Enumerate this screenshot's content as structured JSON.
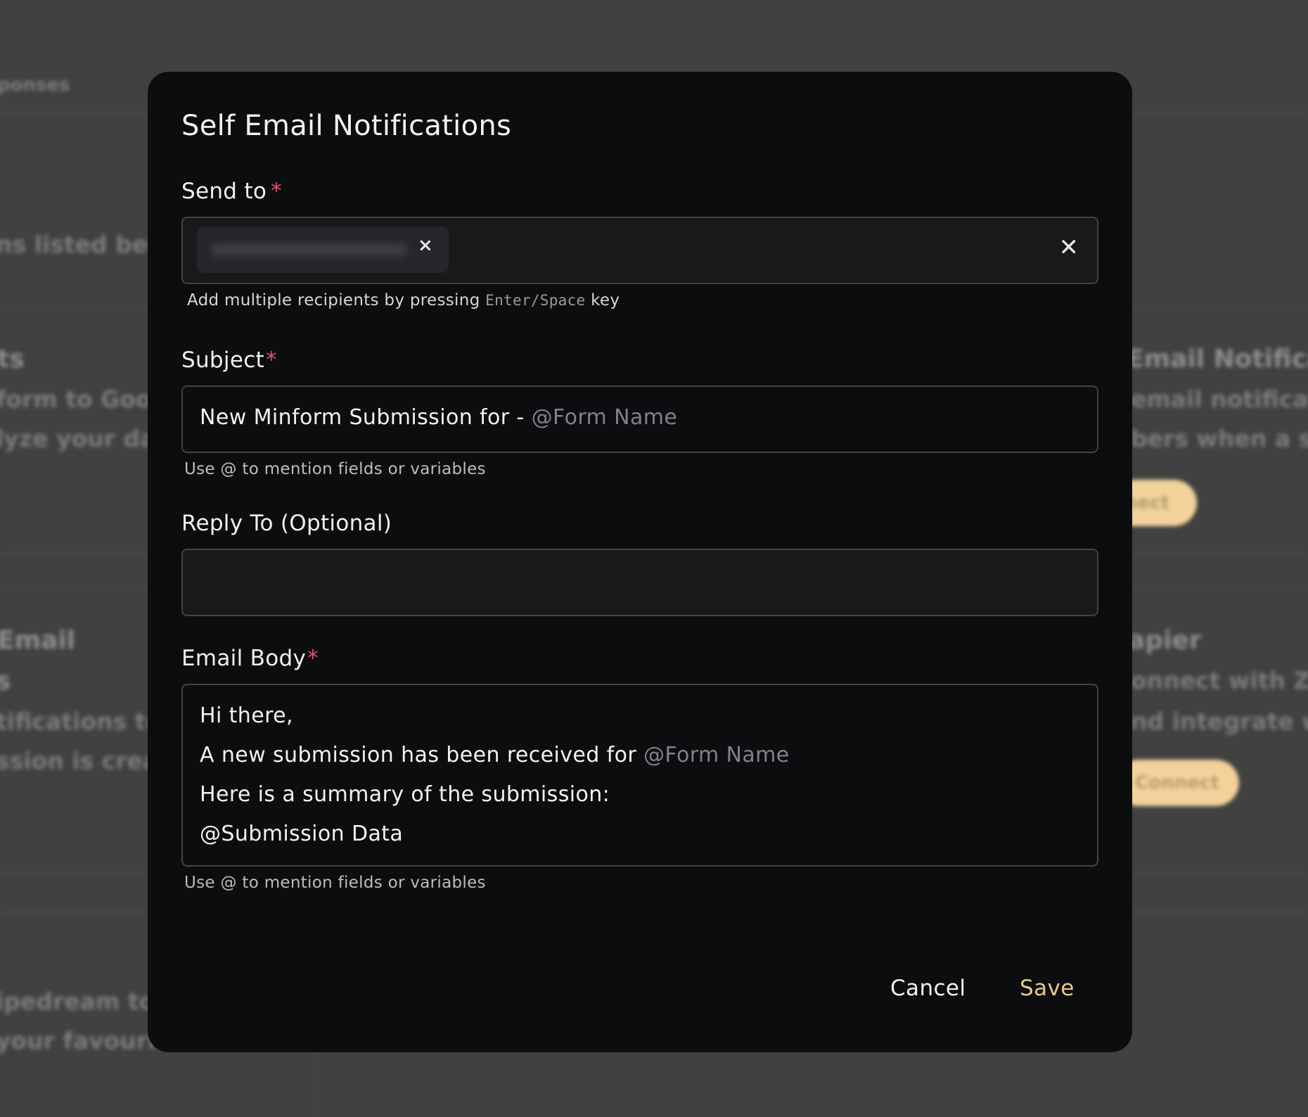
{
  "background": {
    "left_texts": [
      "ponses",
      "ns listed below",
      "ts",
      "form to Googl",
      "lyze your data",
      "Email",
      "s",
      "tifications to y",
      "ssion is created",
      "ipedream to",
      "your favourite"
    ],
    "right_texts": [
      "Email Notificat",
      "email notificatio",
      "bers when a subm",
      "apier",
      "onnect with Zapi",
      "nd integrate with"
    ],
    "right_buttons": [
      "nect",
      "Connect"
    ]
  },
  "modal": {
    "title": "Self Email Notifications",
    "send_to": {
      "label": "Send to",
      "required_mark": "*",
      "chip_remove": "×",
      "clear_all": "✕",
      "help_prefix": "Add multiple recipients by pressing",
      "help_key": "Enter/Space",
      "help_suffix": "key"
    },
    "subject": {
      "label": "Subject",
      "required_mark": "*",
      "value_text": "New Minform Submission for - ",
      "value_mention": "@Form Name",
      "help": "Use @ to mention fields or variables"
    },
    "reply_to": {
      "label": "Reply To (Optional)",
      "value": ""
    },
    "email_body": {
      "label": "Email Body",
      "required_mark": "*",
      "line1": "Hi there,",
      "line2_text": "A new submission has been received for ",
      "line2_mention": "@Form Name",
      "line3": "Here is a summary of the submission:",
      "line4_mention": "@Submission Data",
      "help": "Use @ to mention fields or variables"
    },
    "actions": {
      "cancel": "Cancel",
      "save": "Save"
    }
  },
  "colors": {
    "accent": "#e9c98a",
    "required": "#e2506a",
    "mention": "#80818a",
    "modal_bg": "#0c0d0f"
  }
}
